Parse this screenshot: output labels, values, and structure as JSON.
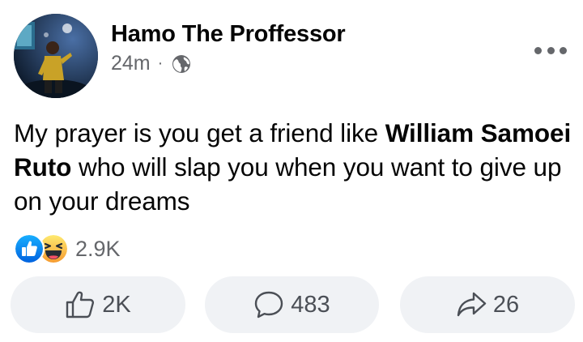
{
  "post": {
    "author": "Hamo The Proffessor",
    "timestamp": "24m",
    "separator": "·",
    "privacy_icon": "globe-icon",
    "more_icon": "more-dots-icon",
    "text_part1": "My prayer is you get a friend like ",
    "text_bold": "William Samoei Ruto",
    "text_part2": " who will slap you when you want to give up on your dreams"
  },
  "reactions": {
    "icons": [
      "like-icon",
      "haha-icon"
    ],
    "count": "2.9K"
  },
  "actions": {
    "like_count": "2K",
    "comment_count": "483",
    "share_count": "26"
  },
  "colors": {
    "text_primary": "#050505",
    "text_secondary": "#65676b",
    "button_bg": "#f0f2f5",
    "like_blue": "#1877f2",
    "haha_yellow": "#f7b928"
  }
}
